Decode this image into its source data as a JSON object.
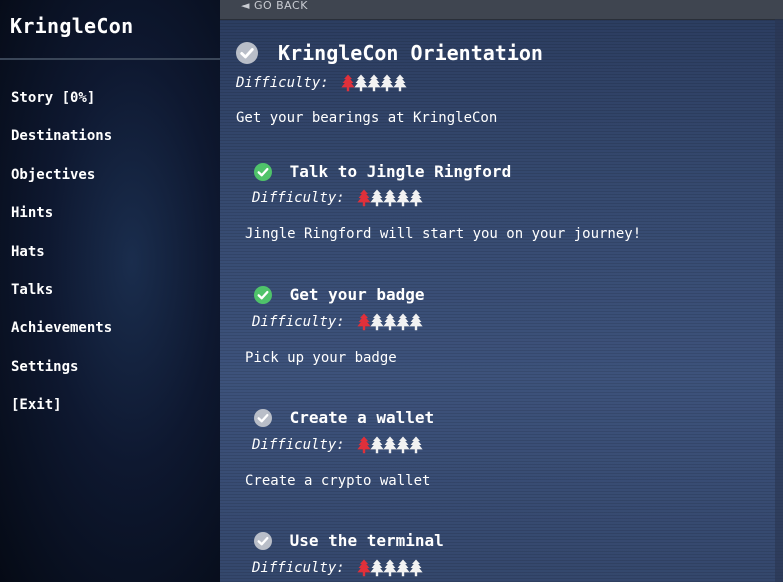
{
  "sidebar": {
    "logo": "KringleCon",
    "items": [
      {
        "label": "Story [0%]"
      },
      {
        "label": "Destinations"
      },
      {
        "label": "Objectives"
      },
      {
        "label": "Hints"
      },
      {
        "label": "Hats"
      },
      {
        "label": "Talks"
      },
      {
        "label": "Achievements"
      },
      {
        "label": "Settings"
      },
      {
        "label": "[Exit]"
      }
    ]
  },
  "header": {
    "go_back": "◄ GO BACK"
  },
  "colors": {
    "difficulty_active": "#e0303a",
    "difficulty_inactive": "#f2f2f2",
    "check_done": "#4fc36a",
    "check_todo": "#b9bec8"
  },
  "objective": {
    "title": "KringleCon Orientation",
    "difficulty_label": "Difficulty:",
    "difficulty": 1,
    "difficulty_max": 5,
    "description": "Get your bearings at KringleCon",
    "status_icon": "check-circle-icon",
    "tasks": [
      {
        "title": "Talk to Jingle Ringford",
        "difficulty_label": "Difficulty:",
        "difficulty": 1,
        "description": "Jingle Ringford will start you on your journey!",
        "completed": true
      },
      {
        "title": "Get your badge",
        "difficulty_label": "Difficulty:",
        "difficulty": 1,
        "description": "Pick up your badge",
        "completed": true
      },
      {
        "title": "Create a wallet",
        "difficulty_label": "Difficulty:",
        "difficulty": 1,
        "description": "Create a crypto wallet",
        "completed": false
      },
      {
        "title": "Use the terminal",
        "difficulty_label": "Difficulty:",
        "difficulty": 1,
        "description": "",
        "completed": false
      }
    ]
  }
}
